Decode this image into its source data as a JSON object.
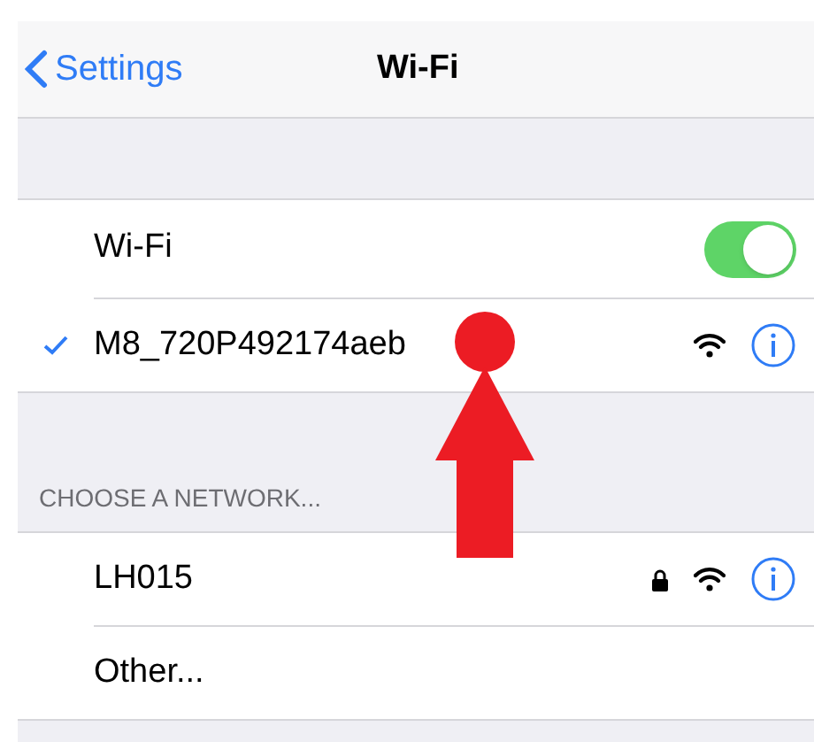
{
  "nav": {
    "back_label": "Settings",
    "title": "Wi-Fi"
  },
  "wifi": {
    "label": "Wi-Fi",
    "on": true
  },
  "current_network": {
    "name": "M8_720P492174aeb",
    "connected": true,
    "locked": false
  },
  "section_header": "CHOOSE A NETWORK...",
  "networks": [
    {
      "kind": "network",
      "name": "LH015",
      "locked": true
    },
    {
      "kind": "other",
      "name": "Other..."
    }
  ]
}
